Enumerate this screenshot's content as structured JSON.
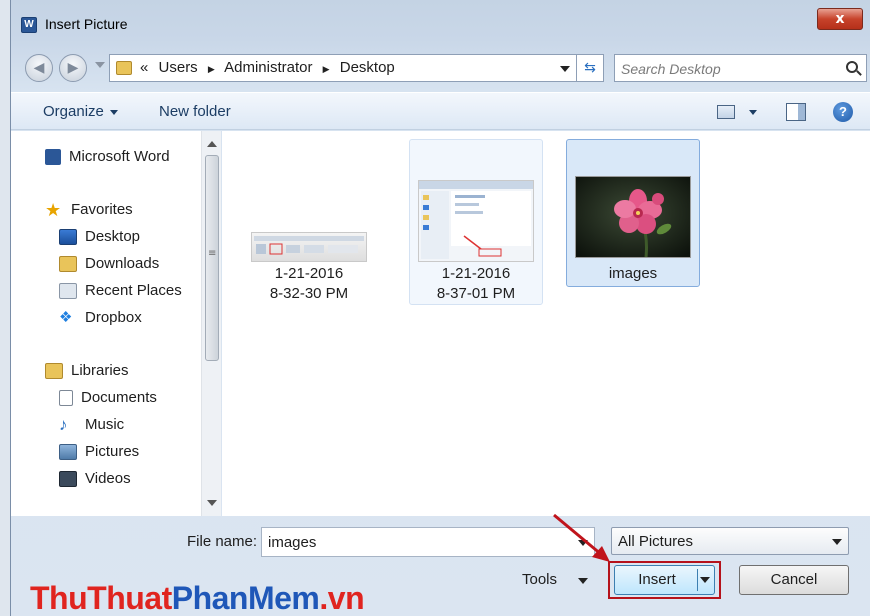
{
  "window": {
    "title": "Insert Picture",
    "close_label": "x"
  },
  "address": {
    "overflow": "«",
    "path": [
      "Users",
      "Administrator",
      "Desktop"
    ],
    "search_placeholder": "Search Desktop"
  },
  "toolbar": {
    "organize": "Organize",
    "new_folder": "New folder",
    "help": "?"
  },
  "nav": {
    "top_item": "Microsoft Word",
    "favorites": {
      "label": "Favorites",
      "items": [
        "Desktop",
        "Downloads",
        "Recent Places",
        "Dropbox"
      ]
    },
    "libraries": {
      "label": "Libraries",
      "items": [
        "Documents",
        "Music",
        "Pictures",
        "Videos"
      ]
    }
  },
  "files": [
    {
      "line1": "1-21-2016",
      "line2": "8-32-30 PM",
      "state": "normal"
    },
    {
      "line1": "1-21-2016",
      "line2": "8-37-01 PM",
      "state": "hover"
    },
    {
      "line1": "images",
      "line2": "",
      "state": "selected"
    }
  ],
  "bottom": {
    "file_name_label": "File name:",
    "file_name_value": "images",
    "file_type": "All Pictures",
    "tools": "Tools",
    "insert": "Insert",
    "cancel": "Cancel"
  },
  "watermark": {
    "part1": "ThuThuat",
    "part2": "PhanMem",
    "part3": ".vn"
  },
  "colors": {
    "highlight_border": "#b5121b",
    "selection": "#d9e8f8",
    "watermark_red": "#e0241f",
    "watermark_blue": "#1f57b8"
  }
}
